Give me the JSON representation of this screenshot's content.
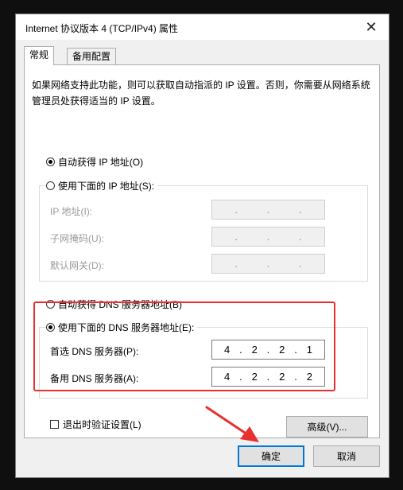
{
  "window": {
    "title": "Internet 协议版本 4 (TCP/IPv4) 属性",
    "close_glyph": "✕"
  },
  "tabs": [
    {
      "label": "常规",
      "active": true
    },
    {
      "label": "备用配置",
      "active": false
    }
  ],
  "description": "如果网络支持此功能，则可以获取自动指派的 IP 设置。否则，你需要从网络系统管理员处获得适当的 IP 设置。",
  "ip_section": {
    "auto_label": "自动获得 IP 地址(O)",
    "manual_label": "使用下面的 IP 地址(S):",
    "selected": "auto",
    "fields": [
      {
        "label": "IP 地址(I):",
        "octets": [
          "",
          "",
          "",
          ""
        ],
        "separator": "."
      },
      {
        "label": "子网掩码(U):",
        "octets": [
          "",
          "",
          "",
          ""
        ],
        "separator": "."
      },
      {
        "label": "默认网关(D):",
        "octets": [
          "",
          "",
          "",
          ""
        ],
        "separator": "."
      }
    ]
  },
  "dns_section": {
    "auto_label": "自动获得 DNS 服务器地址(B)",
    "manual_label": "使用下面的 DNS 服务器地址(E):",
    "selected": "manual",
    "preferred": {
      "label": "首选 DNS 服务器(P):",
      "octets": [
        "4",
        "2",
        "2",
        "1"
      ]
    },
    "alternate": {
      "label": "备用 DNS 服务器(A):",
      "octets": [
        "4",
        "2",
        "2",
        "2"
      ]
    },
    "separator": "."
  },
  "validate_checkbox": {
    "label": "退出时验证设置(L)",
    "checked": false
  },
  "buttons": {
    "advanced": "高级(V)...",
    "ok": "确定",
    "cancel": "取消"
  },
  "annotation": {
    "highlight_color": "#e8302e"
  }
}
